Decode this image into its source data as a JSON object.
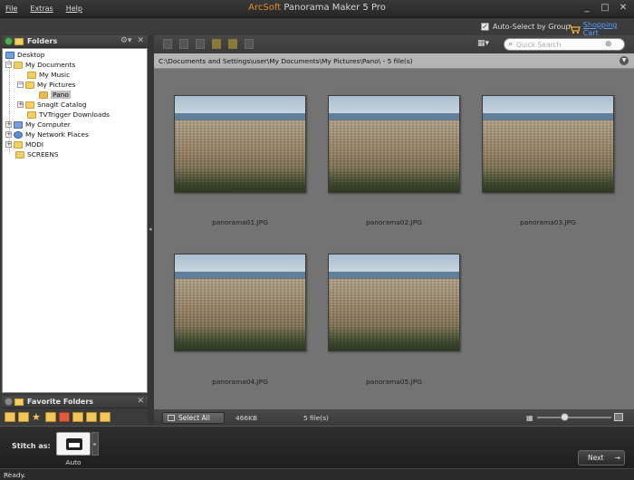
{
  "menu": [
    "File",
    "Extras",
    "Help"
  ],
  "app_title": {
    "brand": "ArcSoft",
    "name": "Panorama Maker 5 Pro"
  },
  "window_controls": [
    "_",
    "□",
    "✕"
  ],
  "top_strip": {
    "auto_select_label": "Auto-Select by Group",
    "auto_select_checked": true,
    "shopping_cart": "Shopping Cart"
  },
  "folders_panel": {
    "title": "Folders",
    "tree": [
      {
        "label": "Desktop",
        "icon": "desktop-icon"
      },
      {
        "label": "My Documents",
        "icon": "folder-icon"
      },
      {
        "label": "My Music",
        "icon": "music-folder-icon"
      },
      {
        "label": "My Pictures",
        "icon": "pictures-folder-icon"
      },
      {
        "label": "Pano",
        "icon": "folder-open-icon",
        "selected": true
      },
      {
        "label": "SnagIt Catalog",
        "icon": "folder-icon"
      },
      {
        "label": "TVTrigger Downloads",
        "icon": "folder-icon"
      },
      {
        "label": "My Computer",
        "icon": "computer-icon"
      },
      {
        "label": "My Network Places",
        "icon": "network-icon"
      },
      {
        "label": "MODI",
        "icon": "folder-icon"
      },
      {
        "label": "SCREENS",
        "icon": "folder-icon"
      }
    ]
  },
  "favorites_panel": {
    "title": "Favorite Folders"
  },
  "search": {
    "placeholder": "Quick Search"
  },
  "path_bar": {
    "text": "C:\\Documents and Settings\\user\\My Documents\\My Pictures\\Pano\\ - 5 file(s)"
  },
  "thumbnails": [
    {
      "filename": "panorama01.JPG"
    },
    {
      "filename": "panorama02.JPG"
    },
    {
      "filename": "panorama03.JPG"
    },
    {
      "filename": "panorama04.JPG"
    },
    {
      "filename": "panorama05.JPG"
    }
  ],
  "status_strip": {
    "select_all": "Select All",
    "size": "466KB",
    "count": "5 file(s)"
  },
  "stitch": {
    "label": "Stitch as:",
    "option": "Auto",
    "next": "Next"
  },
  "status_bar": {
    "text": "Ready."
  },
  "colors": {
    "accent": "#e08a2e",
    "link": "#5aa0ff",
    "gallery_bg": "#737373",
    "path_bg": "#b4b4b4"
  }
}
